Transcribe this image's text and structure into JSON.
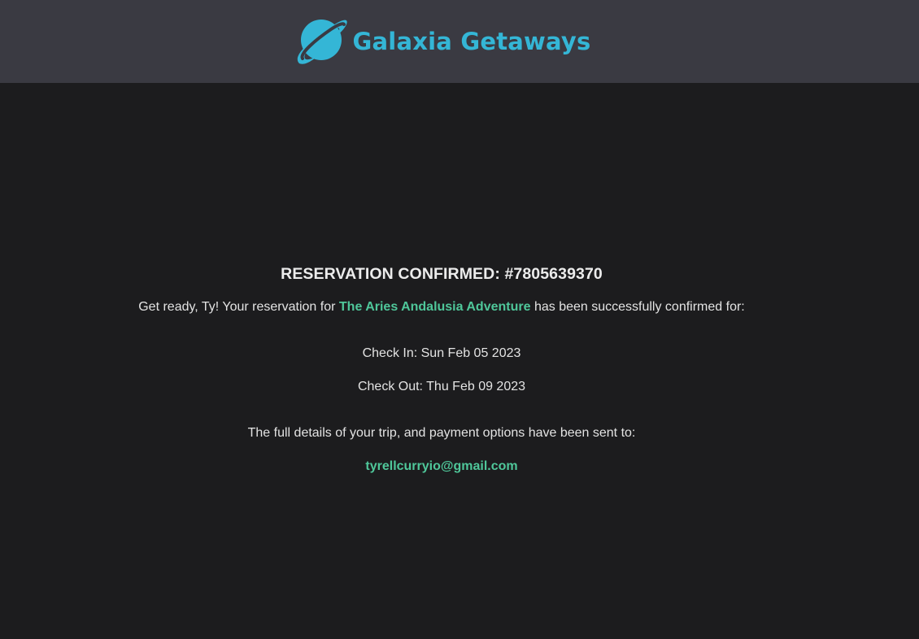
{
  "header": {
    "brand_name": "Galaxia Getaways",
    "logo_icon": "planet-icon",
    "brand_color": "#34b6d6"
  },
  "confirmation": {
    "title": "RESERVATION CONFIRMED: #7805639370",
    "intro_prefix": "Get ready, Ty! Your reservation for",
    "trip_name": "The Aries Andalusia Adventure",
    "intro_suffix": "has been successfully confirmed for:",
    "check_in_label": "Check In: Sun Feb 05 2023",
    "check_out_label": "Check Out: Thu Feb 09 2023",
    "details_text": "The full details of your trip, and payment options have been sent to:",
    "email": "tyrellcurryio@gmail.com",
    "accent_color": "#4fc79a"
  },
  "colors": {
    "header_bg": "#3a3a42",
    "page_bg": "#1c1c1e",
    "text": "#e3e3e3"
  }
}
